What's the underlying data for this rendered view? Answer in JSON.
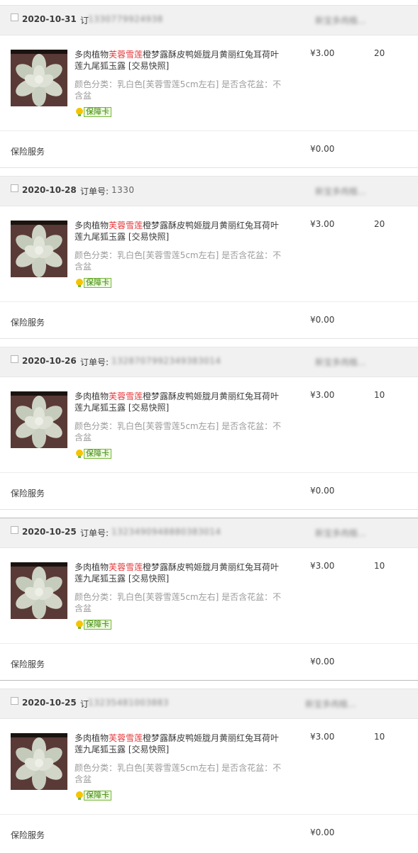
{
  "product": {
    "title_prefix": "多肉植物",
    "title_highlight": "芙蓉雪莲",
    "title_suffix": "橙梦露酥皮鸭姬胧月黄丽红兔耳荷叶莲九尾狐玉露 [交易快照]",
    "spec": "颜色分类：乳白色[芙蓉雪莲5cm左右]  是否含花盆：不含盆",
    "badge_label": "保障卡",
    "price": "¥3.00",
    "insurance_label": "保险服务",
    "insurance_price": "¥0.00"
  },
  "order_number_label": "订单号:",
  "colors": {
    "highlight": "#e4393c",
    "header_bg": "#f1f1f1",
    "badge_green": "#3d8b00"
  },
  "orders": [
    {
      "date": "2020-10-31",
      "order_label": "订",
      "order_number": "1330779924938",
      "shop": "新宝多肉植...",
      "qty": "20"
    },
    {
      "date": "2020-10-28",
      "order_label": "订单号:",
      "order_number": "1330",
      "shop": "新宝多肉植...",
      "qty": "20"
    },
    {
      "date": "2020-10-26",
      "order_label": "订单号:",
      "order_number": "1328707992349383014",
      "shop": "新宝多肉植...",
      "qty": "10"
    },
    {
      "date": "2020-10-25",
      "order_label": "订单号:",
      "order_number": "1323490948880383014",
      "shop": "新宝多肉植...",
      "qty": "10"
    },
    {
      "date": "2020-10-25",
      "order_label": "订",
      "order_number": "13235481003883",
      "shop": "新宝多肉植...",
      "qty": "10"
    }
  ]
}
